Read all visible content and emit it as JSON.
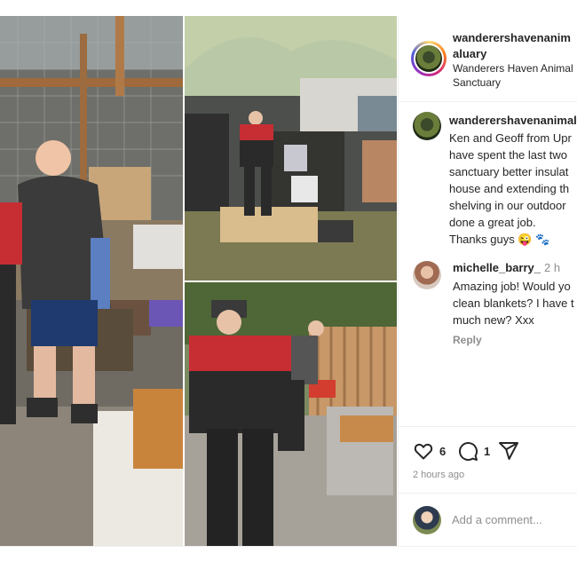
{
  "post": {
    "images": [
      {
        "name": "photo-left",
        "description_icon": "photo"
      },
      {
        "name": "photo-top-right",
        "description_icon": "photo"
      },
      {
        "name": "photo-bottom-right",
        "description_icon": "photo"
      }
    ]
  },
  "header": {
    "username": "wanderershavenanimaluary",
    "display_name": "Wanderers Haven Animal Sanctuary"
  },
  "comments": [
    {
      "username": "wanderershavenanimal",
      "text": "Ken and Geoff from Upr\nhave spent the last two\nsanctuary better insulat\nhouse and extending th\nshelving in our outdoor\ndone a great job.\nThanks guys",
      "emoji_1": "😜",
      "emoji_2": "🐾"
    },
    {
      "username": "michelle_barry_",
      "time": "2 h",
      "text": "Amazing job! Would yo\nclean blankets? I have t\nmuch new? Xxx",
      "reply_label": "Reply"
    }
  ],
  "actions": {
    "like_count": "6",
    "comment_count": "1",
    "posted_ago": "2 hours ago"
  },
  "add_comment": {
    "placeholder": "Add a comment..."
  },
  "colors": {
    "text": "#262626",
    "muted": "#8e8e8e",
    "border": "#efefef"
  }
}
